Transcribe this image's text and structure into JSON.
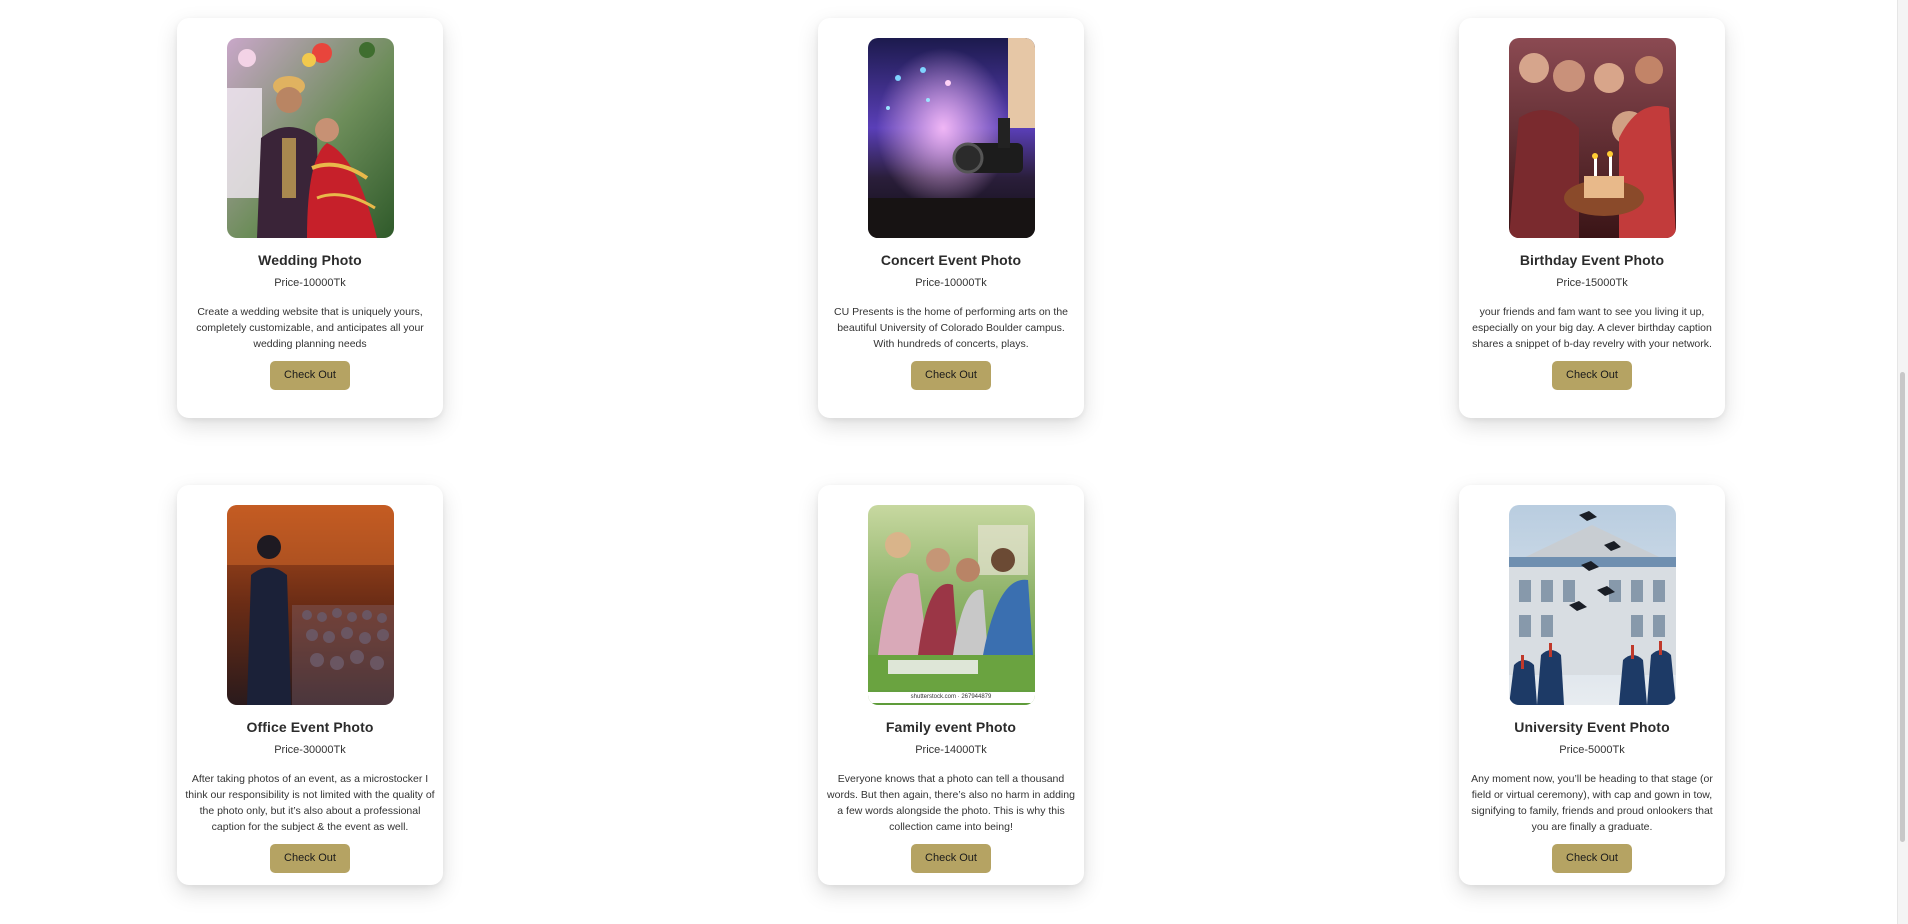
{
  "cards": [
    {
      "title": "Wedding Photo",
      "price": "Price-10000Tk",
      "description": "Create a wedding website that is uniquely yours, completely customizable, and anticipates all your wedding planning needs",
      "button": "Check Out",
      "image": "wedding-couple-photo"
    },
    {
      "title": "Concert Event Photo",
      "price": "Price-10000Tk",
      "description": "CU Presents is the home of performing arts on the beautiful University of Colorado Boulder campus. With hundreds of concerts, plays.",
      "button": "Check Out",
      "image": "concert-stage-photo"
    },
    {
      "title": "Birthday Event Photo",
      "price": "Price-15000Tk",
      "description": "your friends and fam want to see you living it up, especially on your big day. A clever birthday caption shares a snippet of b-day revelry with your network.",
      "button": "Check Out",
      "image": "birthday-party-photo"
    },
    {
      "title": "Office Event Photo",
      "price": "Price-30000Tk",
      "description": "After taking photos of an event, as a microstocker I think our responsibility is not limited with the quality of the photo only, but it’s also about a professional caption for the subject & the event as well.",
      "button": "Check Out",
      "image": "office-conference-photo"
    },
    {
      "title": "Family event Photo",
      "price": "Price-14000Tk",
      "description": "Everyone knows that a photo can tell a thousand words. But then again, there’s also no harm in adding a few words alongside the photo. This is why this collection came into being!",
      "button": "Check Out",
      "image": "family-picnic-photo",
      "image_credit": "shutterstock.com · 267944879"
    },
    {
      "title": "University Event Photo",
      "price": "Price-5000Tk",
      "description": "Any moment now, you’ll be heading to that stage (or field or virtual ceremony), with cap and gown in tow, signifying to family, friends and proud onlookers that you are finally a graduate.",
      "button": "Check Out",
      "image": "graduation-caps-photo"
    }
  ],
  "colors": {
    "button": "#b5a363",
    "card_background": "#ffffff",
    "page_background": "#ffffff"
  }
}
